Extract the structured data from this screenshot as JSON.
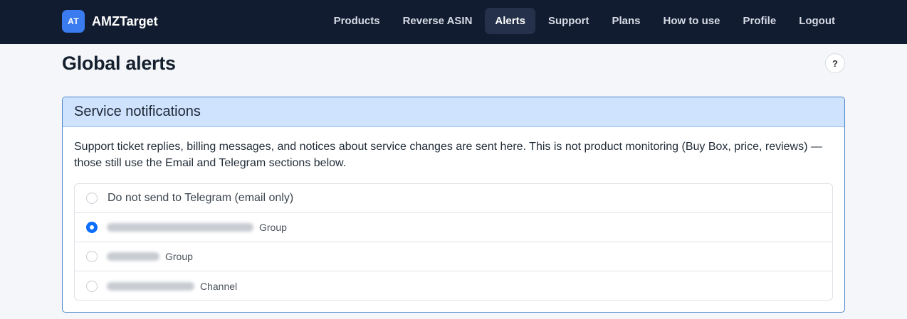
{
  "brand": {
    "logo_text": "AT",
    "name": "AMZTarget"
  },
  "nav": {
    "items": [
      {
        "label": "Products",
        "active": false
      },
      {
        "label": "Reverse ASIN",
        "active": false
      },
      {
        "label": "Alerts",
        "active": true
      },
      {
        "label": "Support",
        "active": false
      },
      {
        "label": "Plans",
        "active": false
      },
      {
        "label": "How to use",
        "active": false
      },
      {
        "label": "Profile",
        "active": false
      },
      {
        "label": "Logout",
        "active": false
      }
    ]
  },
  "page": {
    "title": "Global alerts",
    "help_label": "?"
  },
  "service_notifications": {
    "header": "Service notifications",
    "description": "Support ticket replies, billing messages, and notices about service changes are sent here. This is not product monitoring (Buy Box, price, reviews) — those still use the Email and Telegram sections below.",
    "options": [
      {
        "label": "Do not send to Telegram (email only)",
        "type": "",
        "selected": false
      },
      {
        "label": "",
        "type": "Group",
        "selected": true
      },
      {
        "label": "",
        "type": "Group",
        "selected": false
      },
      {
        "label": "",
        "type": "Channel",
        "selected": false
      }
    ]
  },
  "colors": {
    "navbar_bg": "#121c30",
    "brand_accent": "#3b7bf0",
    "card_header_bg": "#cfe2fe",
    "card_border": "#4a86c8",
    "radio_checked": "#0d6efd"
  }
}
